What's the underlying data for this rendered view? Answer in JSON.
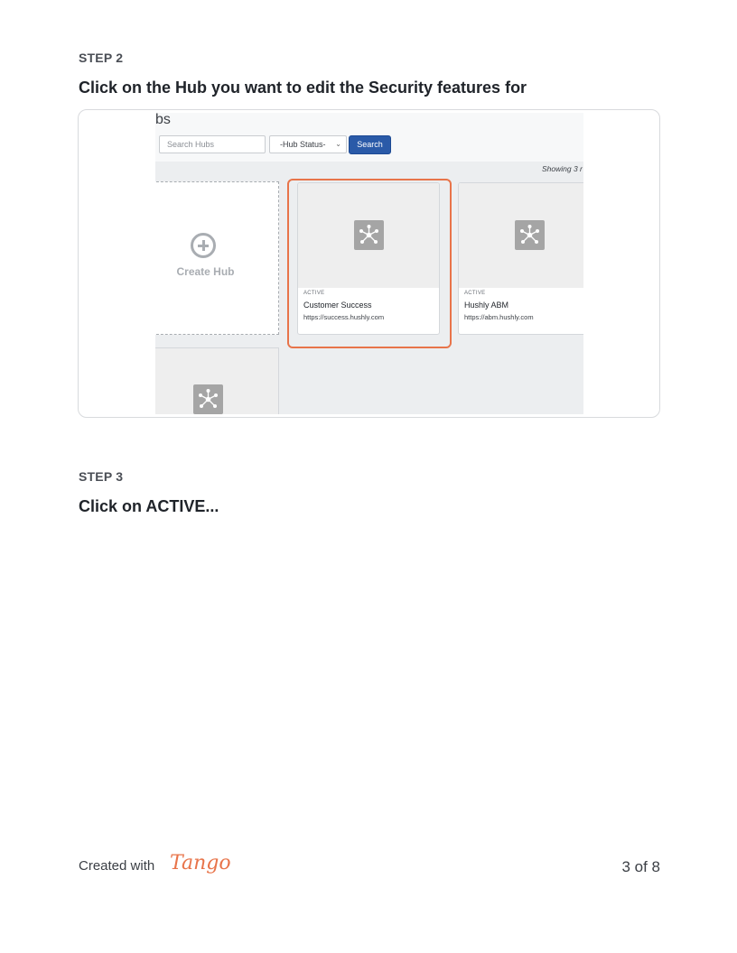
{
  "steps": [
    {
      "label": "STEP 2",
      "title": "Click on the Hub you want to edit the Security features for"
    },
    {
      "label": "STEP 3",
      "title": "Click on ACTIVE..."
    }
  ],
  "screenshot": {
    "page_title": "bs",
    "search_placeholder": "Search Hubs",
    "status_select": "-Hub Status-",
    "search_button": "Search",
    "showing_text": "Showing 3 r",
    "create_hub_label": "Create Hub",
    "hubs": [
      {
        "status": "ACTIVE",
        "name": "Customer Success",
        "url": "https://success.hushly.com",
        "highlighted": true
      },
      {
        "status": "ACTIVE",
        "name": "Hushly ABM",
        "url": "https://abm.hushly.com",
        "highlighted": false
      }
    ],
    "highlight_color": "#e8744a",
    "search_button_color": "#2a5aa8"
  },
  "footer": {
    "created_with": "Created with",
    "brand": "Tango",
    "page": "3 of 8"
  }
}
